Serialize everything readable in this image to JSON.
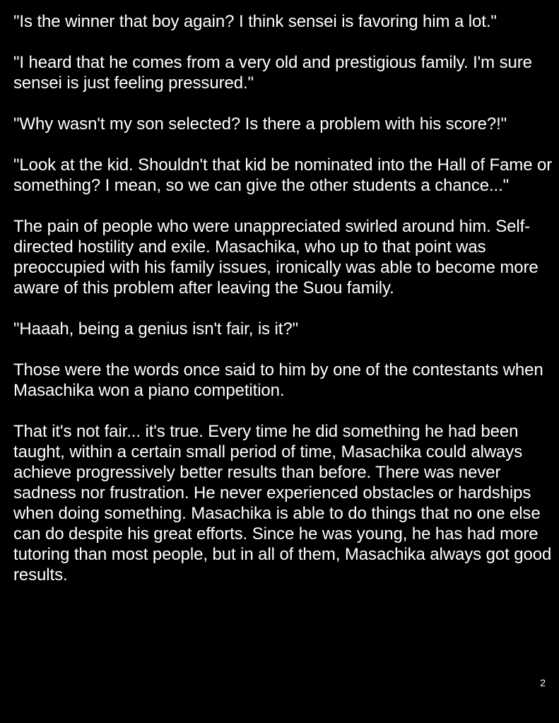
{
  "document": {
    "paragraphs": [
      "\"Is the winner that boy again? I think sensei is favoring him a lot.\"",
      "\"I heard that he comes from a very old and prestigious family. I'm sure sensei is just feeling pressured.\"",
      "\"Why wasn't my son selected? Is there a problem with his score?!\"",
      "\"Look at the kid. Shouldn't that kid be nominated into the Hall of Fame or something? I mean, so we can give the other students a chance...\"",
      "The pain of people who were unappreciated swirled around him. Self-directed hostility and exile. Masachika, who up to that point was preoccupied with his family issues, ironically was able to become more aware of this problem after leaving the Suou family.",
      "\"Haaah, being a genius isn't fair, is it?\"",
      "Those were the words once said to him by one of the contestants when Masachika won a piano competition.",
      "That it's not fair... it's true. Every time he did something he had been taught, within a certain small period of time, Masachika could always achieve progressively better results than before. There was never sadness nor frustration. He never experienced obstacles or hardships when doing something. Masachika is able to do things that no one else can do despite his great efforts. Since he was young, he has had more tutoring than most people, but in all of them, Masachika always got good results."
    ],
    "page_number": "2"
  },
  "colors": {
    "background": "#000000",
    "text": "#ffffff"
  }
}
